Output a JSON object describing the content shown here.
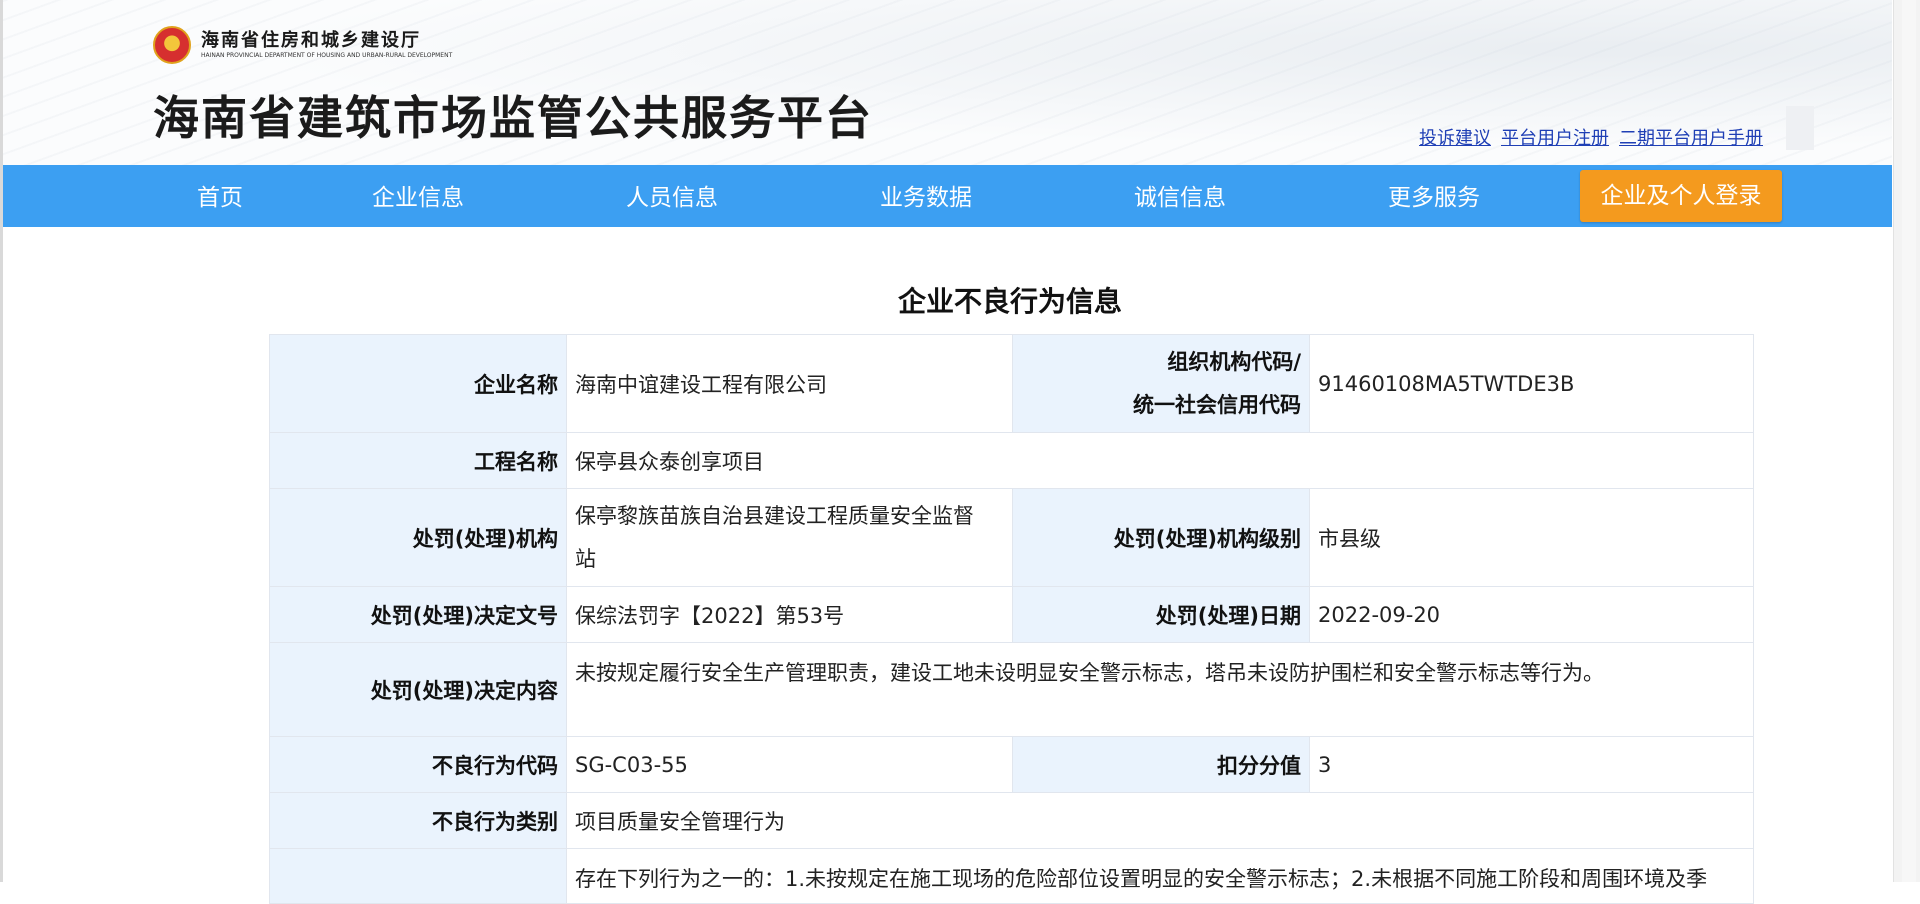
{
  "header": {
    "department_cn": "海南省住房和城乡建设厅",
    "department_en": "HAINAN PROVINCIAL DEPARTMENT OF HOUSING AND URBAN-RURAL DEVELOPMENT",
    "site_title": "海南省建筑市场监管公共服务平台",
    "top_links": [
      "投诉建议",
      "平台用户注册",
      "二期平台用户手册"
    ]
  },
  "nav": {
    "items": [
      "首页",
      "企业信息",
      "人员信息",
      "业务数据",
      "诚信信息",
      "更多服务"
    ],
    "login_label": "企业及个人登录"
  },
  "main": {
    "title": "企业不良行为信息",
    "rows": {
      "company_name_label": "企业名称",
      "company_name": "海南中谊建设工程有限公司",
      "org_code_label_1": "组织机构代码/",
      "org_code_label_2": "统一社会信用代码",
      "org_code": "91460108MA5TWTDE3B",
      "project_name_label": "工程名称",
      "project_name": "保亭县众泰创享项目",
      "penalty_org_label": "处罚(处理)机构",
      "penalty_org_line1": "保亭黎族苗族自治县建设工程质量安全监督",
      "penalty_org_line2": "站",
      "penalty_level_label": "处罚(处理)机构级别",
      "penalty_level": "市县级",
      "decision_no_label": "处罚(处理)决定文号",
      "decision_no": "保综法罚字【2022】第53号",
      "penalty_date_label": "处罚(处理)日期",
      "penalty_date": "2022-09-20",
      "decision_content_label": "处罚(处理)决定内容",
      "decision_content": "未按规定履行安全生产管理职责，建设工地未设明显安全警示标志，塔吊未设防护围栏和安全警示标志等行为。",
      "behavior_code_label": "不良行为代码",
      "behavior_code": "SG-C03-55",
      "deduction_label": "扣分分值",
      "deduction": "3",
      "behavior_type_label": "不良行为类别",
      "behavior_type": "项目质量安全管理行为",
      "next_row_partial": "存在下列行为之一的：1.未按规定在施工现场的危险部位设置明显的安全警示标志；2.未根据不同施工阶段和周围环境及季"
    }
  },
  "colors": {
    "nav_bg": "#3c9ff2",
    "login_btn": "#f49a1e",
    "link": "#1f3fb5",
    "label_bg": "#eaf3fd"
  }
}
